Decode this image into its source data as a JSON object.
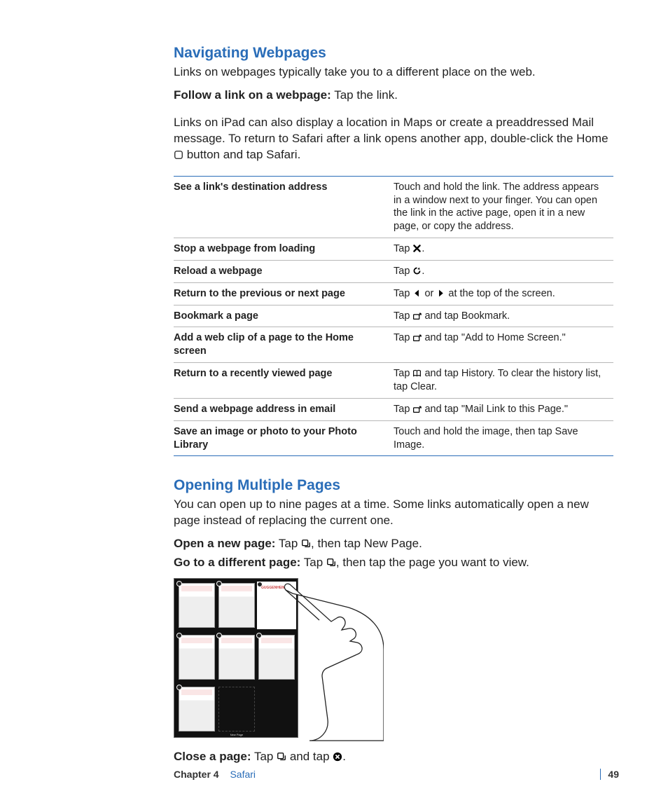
{
  "section1": {
    "title": "Navigating Webpages",
    "intro": "Links on webpages typically take you to a different place on the web.",
    "follow_b": "Follow a link on a webpage:",
    "follow_t": "  Tap the link.",
    "ipad1": "Links on iPad can also display a location in Maps or create a preaddressed Mail message. To return to Safari after a link opens another app, double-click the Home ",
    "ipad2": " button and tap Safari."
  },
  "table": [
    {
      "l": "See a link's destination address",
      "r_pre": "Touch and hold the link. The address appears in a window next to your finger. You can open the link in the active page, open it in a new page, or copy the address.",
      "icon": ""
    },
    {
      "l": "Stop a webpage from loading",
      "r_pre": "Tap ",
      "icon": "x",
      "r_post": "."
    },
    {
      "l": "Reload a webpage",
      "r_pre": "Tap ",
      "icon": "reload",
      "r_post": "."
    },
    {
      "l": "Return to the previous or next page",
      "r_pre": "Tap ",
      "icon": "back",
      "r_mid": " or ",
      "icon2": "fwd",
      "r_post": " at the top of the screen."
    },
    {
      "l": "Bookmark a page",
      "r_pre": "Tap ",
      "icon": "share",
      "r_post": " and tap Bookmark."
    },
    {
      "l": "Add a web clip of a page to the Home screen",
      "r_pre": "Tap ",
      "icon": "share",
      "r_post": " and tap \"Add to Home Screen.\""
    },
    {
      "l": "Return to a recently viewed page",
      "r_pre": "Tap ",
      "icon": "book",
      "r_post": " and tap History. To clear the history list, tap Clear."
    },
    {
      "l": "Send a webpage address in email",
      "r_pre": "Tap ",
      "icon": "share",
      "r_post": " and tap \"Mail Link to this Page.\""
    },
    {
      "l": "Save an image or photo to your Photo Library",
      "r_pre": "Touch and hold the image, then tap Save Image.",
      "icon": ""
    }
  ],
  "section2": {
    "title": "Opening Multiple Pages",
    "intro": "You can open up to nine pages at a time. Some links automatically open a new page instead of replacing the current one.",
    "open_b": "Open a new page:",
    "open_t1": "  Tap ",
    "open_t2": ", then tap New Page.",
    "goto_b": "Go to a different page:",
    "goto_t1": "  Tap ",
    "goto_t2": ", then tap the page you want to view.",
    "close_b": "Close a page:",
    "close_t1": "  Tap ",
    "close_t2": " and tap ",
    "close_t3": "."
  },
  "thumbs": {
    "selected_label": "GUGGENHEIM",
    "newpage": "New Page"
  },
  "footer": {
    "chapter": "Chapter 4",
    "name": "Safari",
    "page": "49"
  }
}
